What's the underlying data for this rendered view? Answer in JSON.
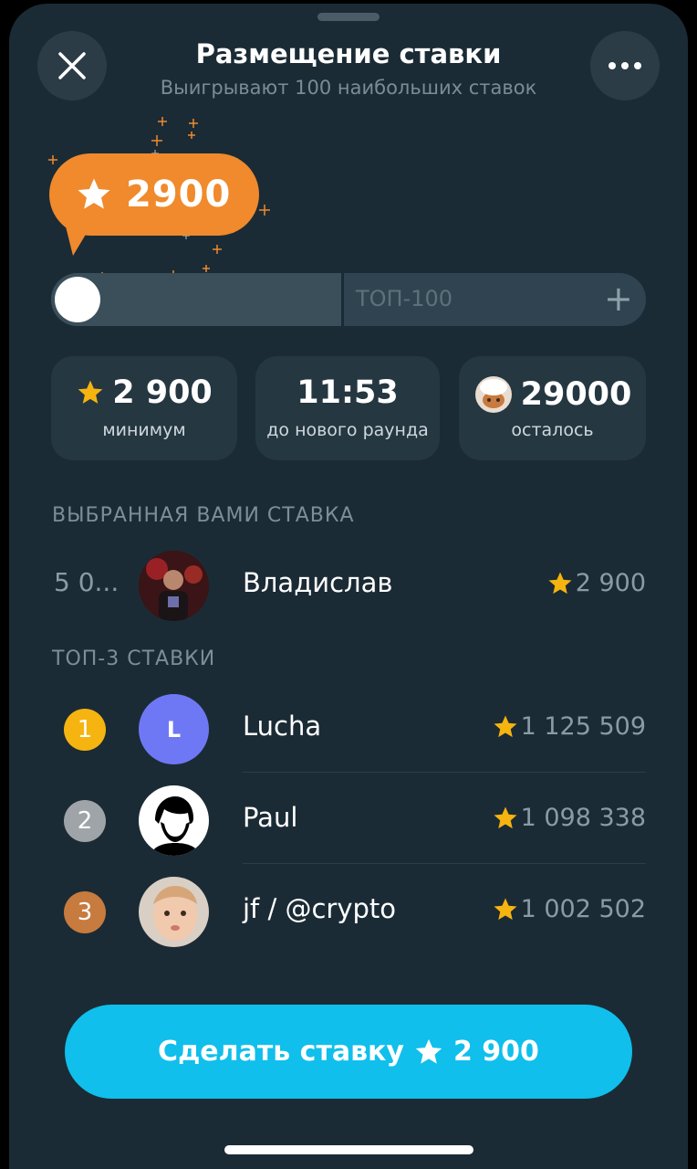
{
  "header": {
    "title": "Размещение ставки",
    "subtitle": "Выигрывают 100 наибольших ставок"
  },
  "bid_bubble": {
    "value": "2900"
  },
  "slider": {
    "label": "ТОП-100",
    "plus": "+",
    "position_fraction": 0.0
  },
  "stats": [
    {
      "value": "2 900",
      "label": "минимум",
      "icon": "star-icon"
    },
    {
      "value": "11:53",
      "label": "до нового раунда"
    },
    {
      "value": "29000",
      "label": "осталось",
      "icon": "item-icon"
    }
  ],
  "your_bid": {
    "section_label": "ВЫБРАННАЯ ВАМИ СТАВКА",
    "rank": "5 0...",
    "name": "Владислав",
    "amount": "2 900"
  },
  "top3": {
    "section_label": "ТОП-3 СТАВКИ",
    "rows": [
      {
        "rank": "1",
        "name": "Lucha",
        "amount": "1 125 509",
        "avatar_letter": "L",
        "medal_color": "#f5b40f"
      },
      {
        "rank": "2",
        "name": "Paul",
        "amount": "1 098 338",
        "medal_color": "#9ea4a8"
      },
      {
        "rank": "3",
        "name": "jf / @crypto",
        "amount": "1 002 502",
        "medal_color": "#c77b3f"
      }
    ]
  },
  "cta": {
    "label": "Сделать ставку",
    "amount": "2 900"
  },
  "colors": {
    "background": "#1b2b35",
    "accent_orange": "#f08a2c",
    "cta_blue": "#10bfeb",
    "star_gold": "#f5b40f"
  }
}
